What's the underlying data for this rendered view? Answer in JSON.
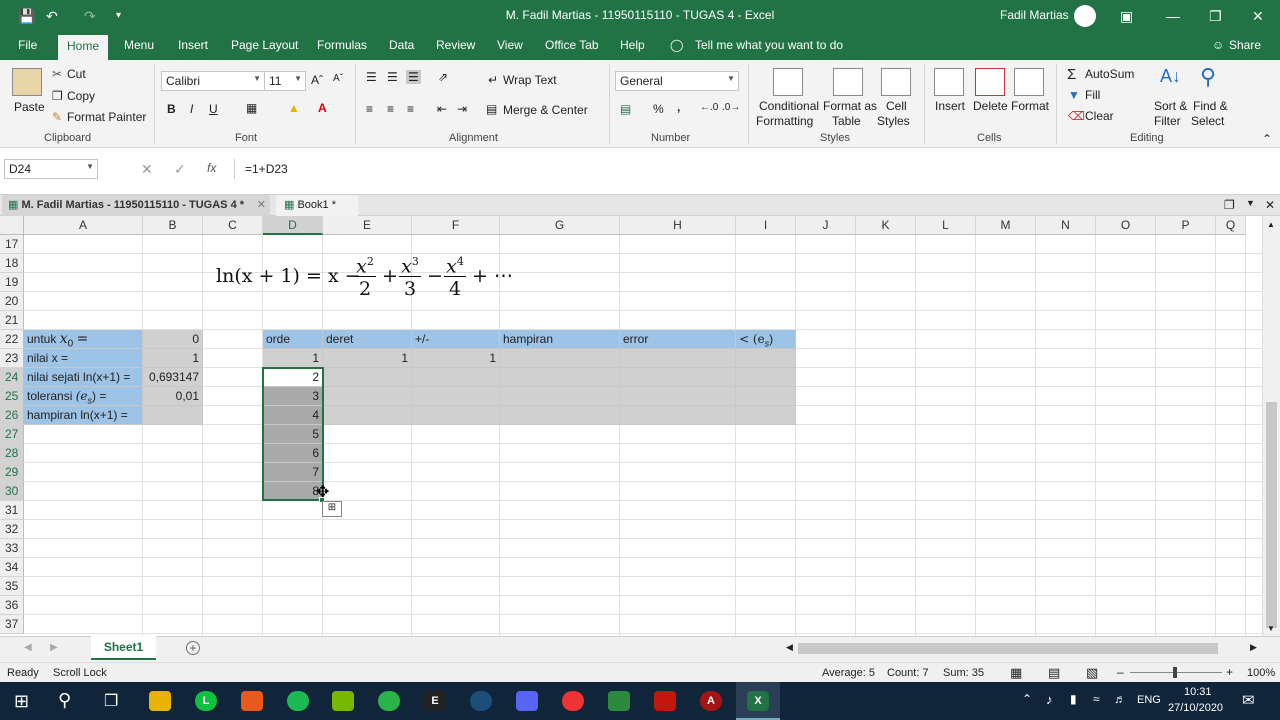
{
  "window": {
    "title": "M. Fadil Martias - 11950115110 - TUGAS 4  -  Excel",
    "user": "Fadil Martias"
  },
  "ribbon_tabs": [
    "File",
    "Home",
    "Menu",
    "Insert",
    "Page Layout",
    "Formulas",
    "Data",
    "Review",
    "View",
    "Office Tab",
    "Help"
  ],
  "tell_me": "Tell me what you want to do",
  "share": "Share",
  "clipboard": {
    "paste": "Paste",
    "cut": "Cut",
    "copy": "Copy",
    "format_painter": "Format Painter",
    "group": "Clipboard"
  },
  "font": {
    "name": "Calibri",
    "size": "11",
    "bold": "B",
    "italic": "I",
    "underline": "U",
    "group": "Font"
  },
  "alignment": {
    "wrap": "Wrap Text",
    "merge": "Merge & Center",
    "group": "Alignment"
  },
  "number": {
    "format": "General",
    "percent": "%",
    "comma": ",",
    "group": "Number"
  },
  "styles": {
    "conditional": "Conditional",
    "conditional2": "Formatting",
    "format_as": "Format as",
    "format_as2": "Table",
    "cell_styles": "Cell",
    "cell_styles2": "Styles",
    "group": "Styles"
  },
  "cells_grp": {
    "insert": "Insert",
    "delete": "Delete",
    "format": "Format",
    "group": "Cells"
  },
  "editing": {
    "autosum": "AutoSum",
    "fill": "Fill",
    "clear": "Clear",
    "sort": "Sort &",
    "sort2": "Filter",
    "find": "Find &",
    "find2": "Select",
    "group": "Editing"
  },
  "formula_bar": {
    "name_box": "D24",
    "formula": "=1+D23",
    "fx": "fx"
  },
  "workbook_tabs": [
    "M. Fadil Martias - 11950115110 - TUGAS 4 *",
    "Book1 *"
  ],
  "columns": [
    "A",
    "B",
    "C",
    "D",
    "E",
    "F",
    "G",
    "H",
    "I",
    "J",
    "K",
    "L",
    "M",
    "N",
    "O",
    "P",
    "Q"
  ],
  "rows": [
    "17",
    "18",
    "19",
    "20",
    "21",
    "22",
    "23",
    "24",
    "25",
    "26",
    "27",
    "28",
    "29",
    "30",
    "31",
    "32",
    "33",
    "34",
    "35",
    "36",
    "37"
  ],
  "formula_image": {
    "lhs": "ln(x + 1) = x −",
    "t1n": "x",
    "t1e": "2",
    "t1d": "2",
    "t2n": "x",
    "t2e": "3",
    "t2d": "3",
    "t3n": "x",
    "t3e": "4",
    "t3d": "4",
    "tail": "+ ⋯",
    "plus": "+",
    "minus": "−"
  },
  "cells": {
    "A22": "untuk",
    "A22b": "x",
    "A22sub": "0",
    "A22eq": "=",
    "B22": "0",
    "A23": "nilai x =",
    "B23": "1",
    "A24": "nilai sejati ln(x+1) =",
    "B24": "0,693147",
    "A25": "toleransi",
    "A25e": "(e",
    "A25s": "s",
    "A25c": ") =",
    "B25": "0,01",
    "A26": "hampiran ln(x+1) =",
    "D22": "orde",
    "E22": "deret",
    "F22": "+/-",
    "G22": "hampiran",
    "H22": "error",
    "I22": "< (e",
    "I22s": "s",
    "I22c": ")",
    "D23": "1",
    "E23": "1",
    "F23": "1",
    "D24": "2",
    "D25": "3",
    "D26": "4",
    "D27": "5",
    "D28": "6",
    "D29": "7",
    "D30": "8"
  },
  "sheet_tab": "Sheet1",
  "status": {
    "ready": "Ready",
    "scroll_lock": "Scroll Lock",
    "average": "Average: 5",
    "count": "Count: 7",
    "sum": "Sum: 35",
    "zoom": "100%"
  },
  "taskbar": {
    "lang": "ENG",
    "time": "10:31",
    "date": "27/10/2020"
  }
}
